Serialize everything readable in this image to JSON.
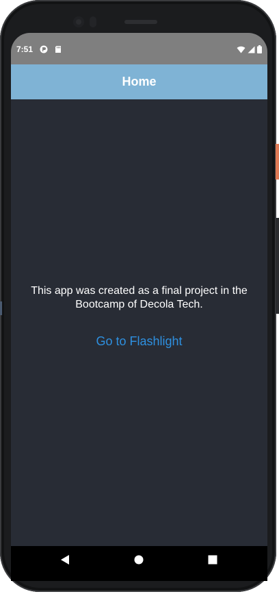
{
  "status_bar": {
    "time": "7:51",
    "left_icons": [
      "notification-app-icon",
      "sd-card-icon"
    ],
    "right_icons": [
      "wifi-icon",
      "cell-signal-icon",
      "battery-icon"
    ]
  },
  "app_bar": {
    "title": "Home"
  },
  "content": {
    "description": "This app was created as a final project in the Bootcamp of Decola Tech.",
    "link_label": "Go to Flashlight"
  },
  "nav_bar": {
    "items": [
      "back-icon",
      "home-icon",
      "recents-icon"
    ]
  },
  "colors": {
    "status_bar": "#7f7f7f",
    "app_bar": "#7fb3d5",
    "background": "#282c35",
    "link": "#2e90e0",
    "nav_bar": "#000000"
  }
}
